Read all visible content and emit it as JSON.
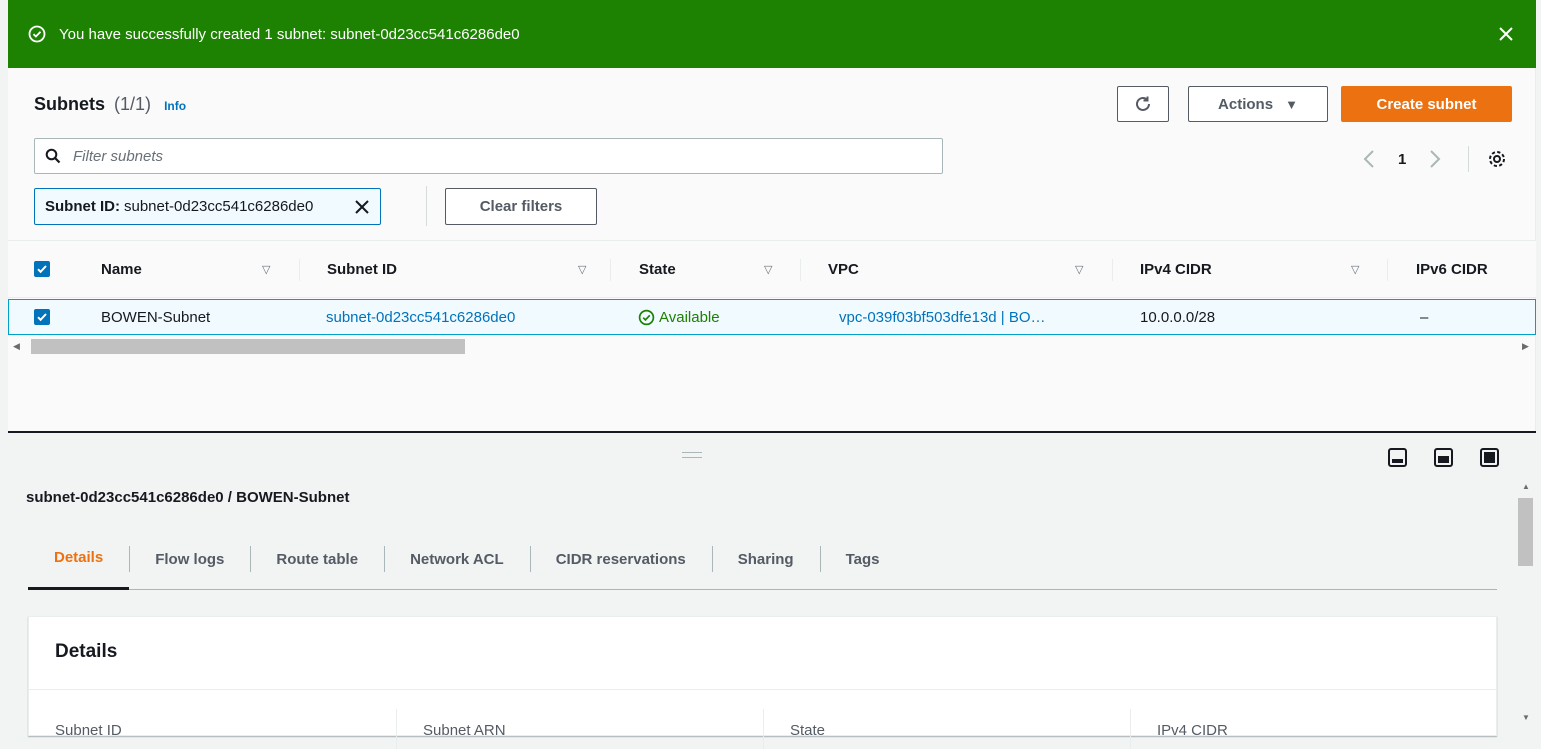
{
  "flash": {
    "message": "You have successfully created 1 subnet: subnet-0d23cc541c6286de0",
    "color": "#1d8102"
  },
  "header": {
    "title": "Subnets",
    "count": "(1/1)",
    "info": "Info",
    "actions_label": "Actions",
    "create_label": "Create subnet"
  },
  "search": {
    "placeholder": "Filter subnets"
  },
  "pagination": {
    "current_page": "1"
  },
  "filter_token": {
    "label": "Subnet ID:",
    "value": "subnet-0d23cc541c6286de0"
  },
  "clear_filters_label": "Clear filters",
  "table": {
    "columns": [
      "Name",
      "Subnet ID",
      "State",
      "VPC",
      "IPv4 CIDR",
      "IPv6 CIDR"
    ],
    "rows": [
      {
        "name": "BOWEN-Subnet",
        "subnet_id": "subnet-0d23cc541c6286de0",
        "state": "Available",
        "vpc": "vpc-039f03bf503dfe13d | BO…",
        "ipv4": "10.0.0.0/28",
        "ipv6": "–",
        "selected": true
      }
    ]
  },
  "detail": {
    "title": "subnet-0d23cc541c6286de0 / BOWEN-Subnet",
    "tabs": [
      "Details",
      "Flow logs",
      "Route table",
      "Network ACL",
      "CIDR reservations",
      "Sharing",
      "Tags"
    ],
    "active_tab": "Details",
    "card_title": "Details",
    "columns": [
      "Subnet ID",
      "Subnet ARN",
      "State",
      "IPv4 CIDR"
    ]
  },
  "colors": {
    "accent_orange": "#ec7211",
    "link_blue": "#0073bb",
    "success_green": "#1d8102"
  }
}
